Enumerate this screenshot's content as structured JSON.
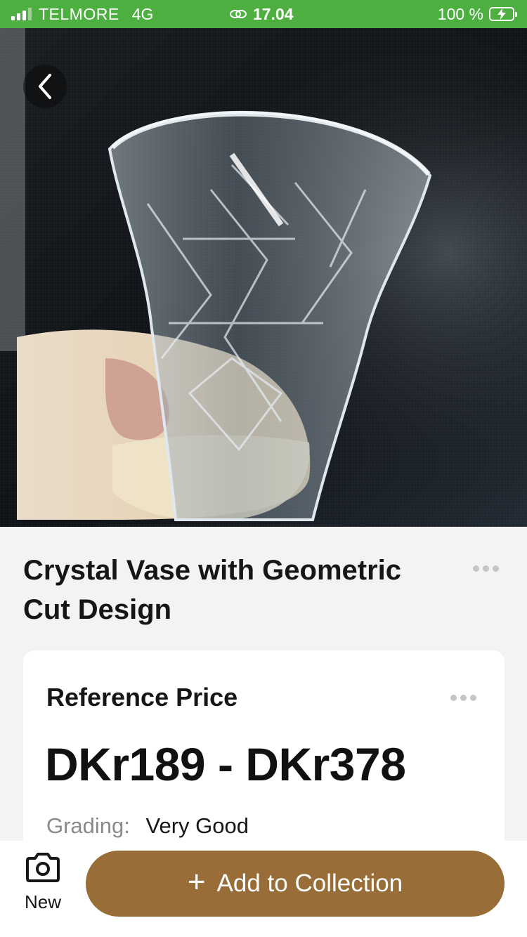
{
  "colors": {
    "status_bar_bg": "#4caf3f",
    "accent_button": "#986d37",
    "page_bg": "#f3f3f3",
    "card_bg": "#ffffff"
  },
  "status_bar": {
    "carrier": "TELMORE",
    "network": "4G",
    "time": "17.04",
    "battery_percent": "100 %",
    "signal_bars": 3,
    "signal_max": 4
  },
  "item": {
    "title": "Crystal Vase with Geometric Cut Design",
    "photo_icon": "crystal-vase-photo"
  },
  "price_card": {
    "title": "Reference Price",
    "price_range": "DKr189 - DKr378",
    "grading_label": "Grading:",
    "grading_value": "Very Good"
  },
  "bottom_bar": {
    "new_label": "New",
    "new_icon": "camera-icon",
    "add_button_label": "Add to Collection",
    "add_icon": "plus-icon"
  }
}
